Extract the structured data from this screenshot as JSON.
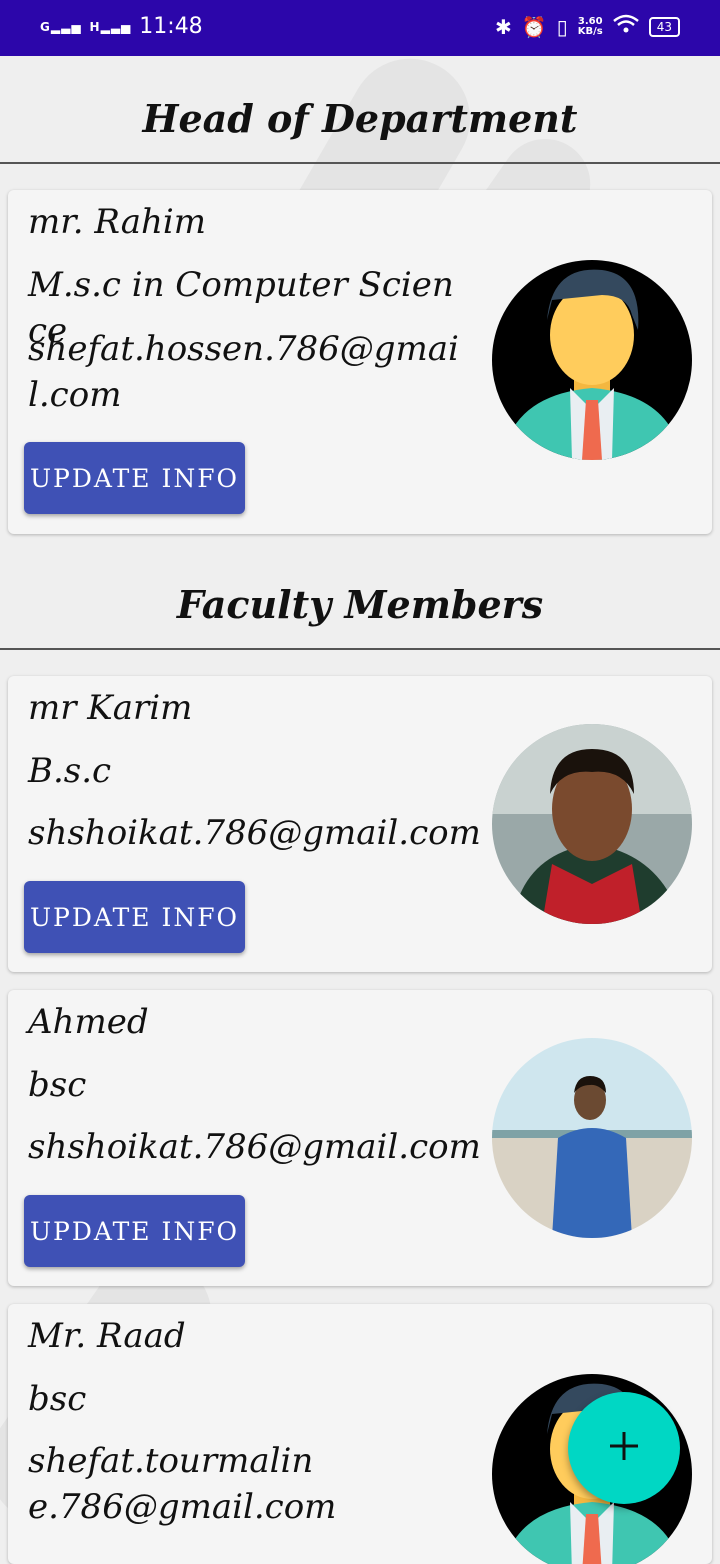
{
  "status_bar": {
    "signal_1": "G",
    "signal_2": "H",
    "time": "11:48",
    "net_speed_value": "3.60",
    "net_speed_unit": "KB/s",
    "battery": "43",
    "icons": [
      "bluetooth-icon",
      "alarm-icon",
      "vibrate-icon",
      "wifi-icon",
      "battery-icon"
    ]
  },
  "head_section": {
    "title": "Head of Department",
    "card": {
      "name": "mr. Rahim",
      "degree": "M.s.c in Computer Science",
      "email": "shefat.hossen.786@gmail.com",
      "button": "UPDATE INFO",
      "avatar": "default-male-avatar"
    }
  },
  "faculty_section": {
    "title": "Faculty Members",
    "cards": [
      {
        "name": "mr Karim",
        "degree": "B.s.c",
        "email": "shshoikat.786@gmail.com",
        "button": "UPDATE INFO",
        "avatar": "photo-portrait"
      },
      {
        "name": "Ahmed",
        "degree": "bsc",
        "email": "shshoikat.786@gmail.com",
        "button": "UPDATE INFO",
        "avatar": "photo-beach"
      },
      {
        "name": "Mr. Raad",
        "degree": "bsc",
        "email": "shefat.tourmaline.786@gmail.com",
        "avatar": "default-male-avatar"
      }
    ]
  },
  "fab": {
    "icon": "plus-icon",
    "label": "+"
  },
  "colors": {
    "status_bar": "#2c06aa",
    "button": "#3f51b5",
    "fab": "#00d7c4",
    "card": "#f5f5f5"
  }
}
